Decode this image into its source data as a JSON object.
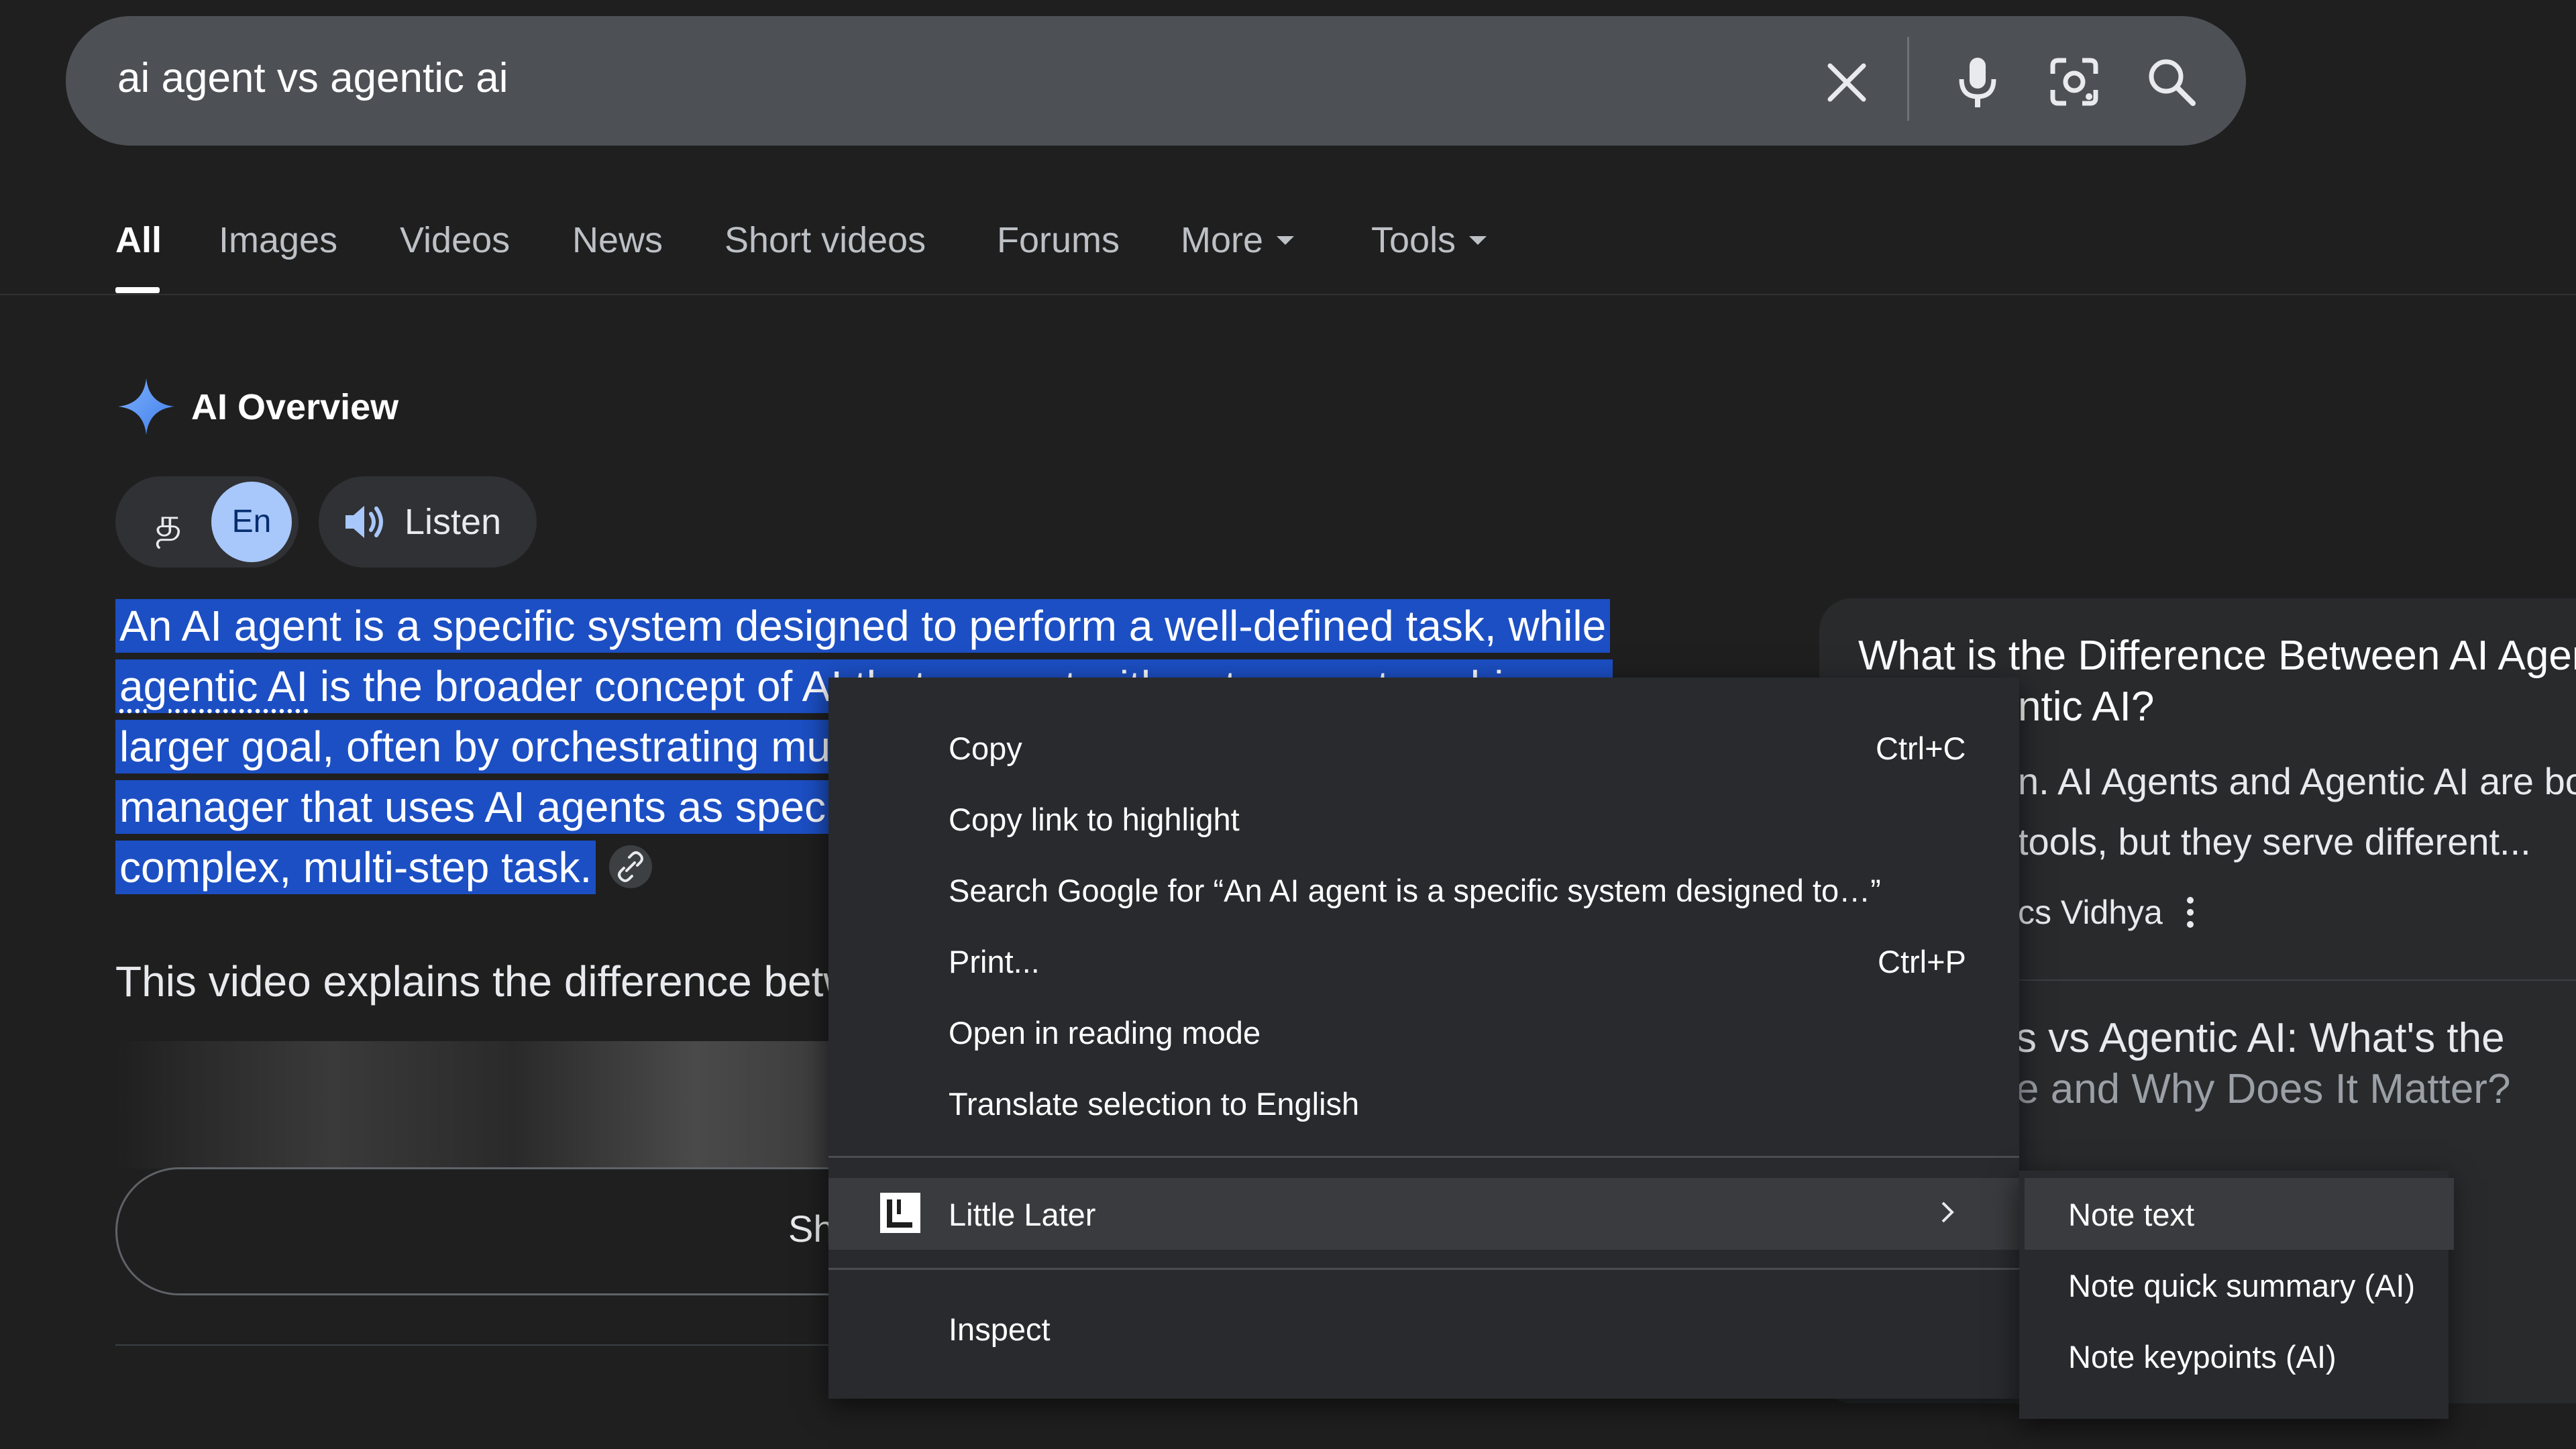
{
  "search": {
    "query": "ai agent vs agentic ai"
  },
  "icons": {
    "clear": "close-icon",
    "mic": "microphone-icon",
    "lens": "google-lens-icon",
    "search": "search-icon",
    "spark": "ai-sparkle-icon",
    "speaker": "speaker-icon",
    "link": "link-icon",
    "kebab": "more-vert-icon",
    "little_later": "little-later-logo-icon",
    "submenu_arrow": "chevron-right-icon"
  },
  "tabs": [
    {
      "label": "All",
      "active": true
    },
    {
      "label": "Images"
    },
    {
      "label": "Videos"
    },
    {
      "label": "News"
    },
    {
      "label": "Short videos"
    },
    {
      "label": "Forums"
    },
    {
      "label": "More",
      "dropdown": true
    },
    {
      "label": "Tools",
      "dropdown": true
    }
  ],
  "ai_overview": {
    "title": "AI Overview",
    "lang_script": "த",
    "lang_en": "En",
    "listen_label": "Listen",
    "paragraph": {
      "part1": "An AI agent is a specific system designed to perform a well-defined task, while ",
      "term": "agentic AI",
      "part2": " is the broader concept of AI that can act with autonomy to achieve a larger goal, often by orchestrating multiple AI agents. Think of it as an overall manager that uses AI agents as specialized workers to handle different parts of a complex, multi-step task."
    },
    "video_caption": "This video explains the difference betw",
    "show_more_label": "Sh"
  },
  "source_card": {
    "title": "What is the Difference Between AI Agents and Agentic AI?",
    "title_visible": "What is the Difference Between AI Agen",
    "title_line2": "ntic AI?",
    "snippet_line1": "n. AI Agents and Agentic AI are bot",
    "snippet_line2": "tools, but they serve different...",
    "source_name": "cs Vidhya",
    "second_title_line1": "s vs Agentic AI: What's the",
    "second_title_line2": "e and Why Does It Matter?"
  },
  "context_menu": {
    "items": [
      {
        "label": "Copy",
        "shortcut": "Ctrl+C"
      },
      {
        "label": "Copy link to highlight"
      },
      {
        "label": "Search Google for “An AI agent is a specific system designed to…”"
      },
      {
        "label": "Print...",
        "shortcut": "Ctrl+P"
      },
      {
        "label": "Open in reading mode"
      },
      {
        "label": "Translate selection to English"
      },
      {
        "label": "Little Later",
        "submenu": true
      },
      {
        "label": "Inspect"
      }
    ]
  },
  "submenu": {
    "items": [
      {
        "label": "Note text"
      },
      {
        "label": "Note quick summary (AI)"
      },
      {
        "label": "Note keypoints (AI)"
      }
    ]
  },
  "colors": {
    "background": "#1f1f1f",
    "search_bar": "#4d5156",
    "selection_highlight": "#1c4fc4",
    "lang_active": "#a8c7fa",
    "menu_bg": "#292a2d",
    "menu_hover": "#3a3b3e",
    "spark_blue": "#4c8df6"
  }
}
